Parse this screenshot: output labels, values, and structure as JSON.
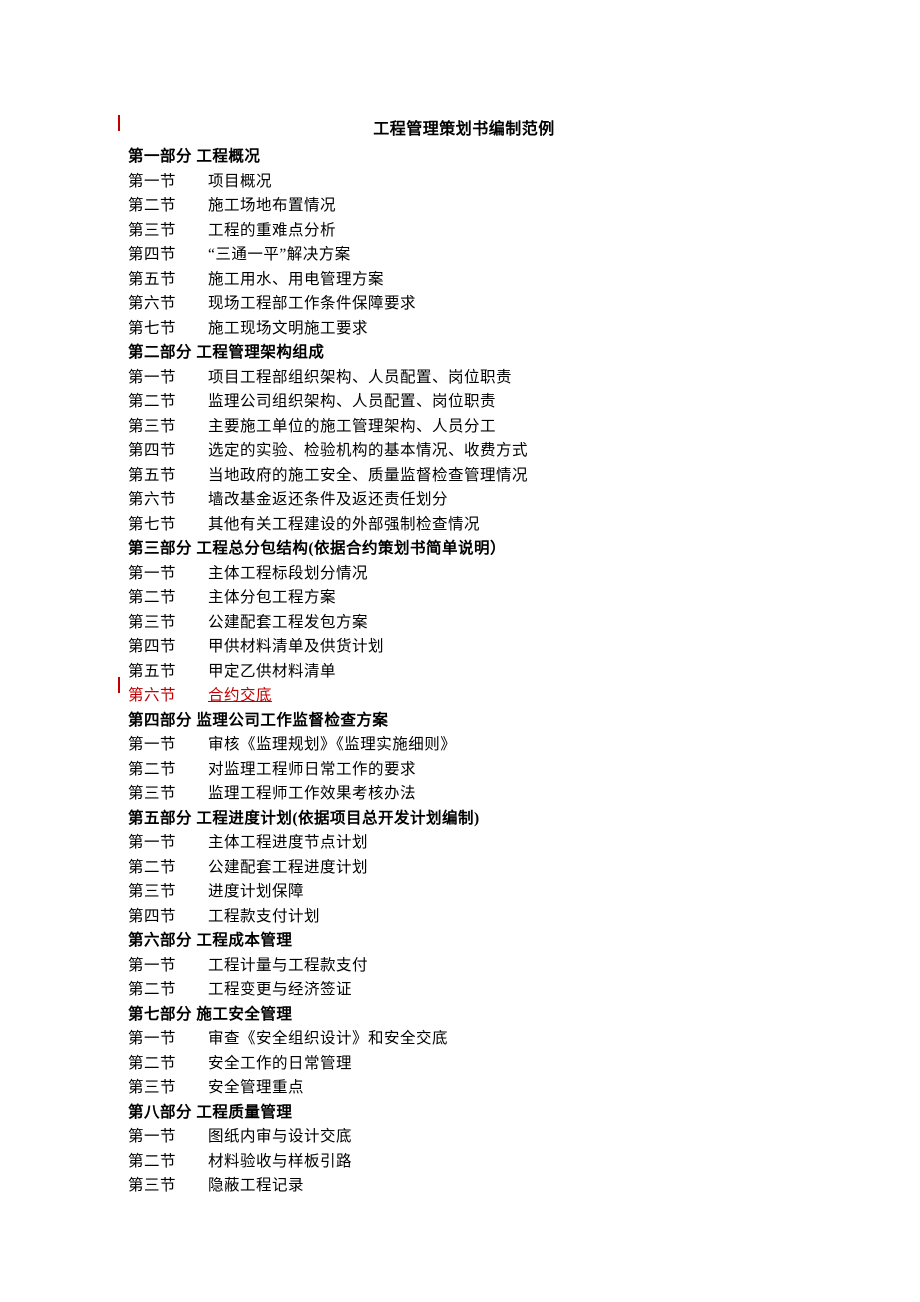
{
  "title": "工程管理策划书编制范例",
  "parts": [
    {
      "label": "第一部分",
      "name": "工程概况",
      "sections": [
        {
          "label": "第一节",
          "text": "项目概况"
        },
        {
          "label": "第二节",
          "text": "施工场地布置情况"
        },
        {
          "label": "第三节",
          "text": "工程的重难点分析"
        },
        {
          "label": "第四节",
          "text": "“三通一平”解决方案"
        },
        {
          "label": "第五节",
          "text": "施工用水、用电管理方案"
        },
        {
          "label": "第六节",
          "text": "现场工程部工作条件保障要求"
        },
        {
          "label": "第七节",
          "text": "施工现场文明施工要求"
        }
      ]
    },
    {
      "label": "第二部分",
      "name": "工程管理架构组成",
      "sections": [
        {
          "label": "第一节",
          "text": "项目工程部组织架构、人员配置、岗位职责"
        },
        {
          "label": "第二节",
          "text": "监理公司组织架构、人员配置、岗位职责"
        },
        {
          "label": "第三节",
          "text": "主要施工单位的施工管理架构、人员分工"
        },
        {
          "label": "第四节",
          "text": "选定的实验、检验机构的基本情况、收费方式"
        },
        {
          "label": "第五节",
          "text": "当地政府的施工安全、质量监督检查管理情况"
        },
        {
          "label": "第六节",
          "text": "墙改基金返还条件及返还责任划分"
        },
        {
          "label": "第七节",
          "text": "其他有关工程建设的外部强制检查情况"
        }
      ]
    },
    {
      "label": "第三部分",
      "name": "工程总分包结构(依据合约策划书简单说明）",
      "sections": [
        {
          "label": "第一节",
          "text": "主体工程标段划分情况"
        },
        {
          "label": "第二节",
          "text": "主体分包工程方案"
        },
        {
          "label": "第三节",
          "text": "公建配套工程发包方案"
        },
        {
          "label": "第四节",
          "text": "甲供材料清单及供货计划"
        },
        {
          "label": "第五节",
          "text": "甲定乙供材料清单"
        },
        {
          "label": "第六节",
          "text": "合约交底",
          "highlight": true
        }
      ]
    },
    {
      "label": "第四部分",
      "name": "监理公司工作监督检查方案",
      "sections": [
        {
          "label": "第一节",
          "text": "审核《监理规划》《监理实施细则》"
        },
        {
          "label": "第二节",
          "text": "对监理工程师日常工作的要求"
        },
        {
          "label": "第三节",
          "text": "监理工程师工作效果考核办法"
        }
      ]
    },
    {
      "label": "第五部分",
      "name": "工程进度计划(依据项目总开发计划编制)",
      "sections": [
        {
          "label": "第一节",
          "text": "主体工程进度节点计划"
        },
        {
          "label": "第二节",
          "text": "公建配套工程进度计划"
        },
        {
          "label": "第三节",
          "text": "进度计划保障"
        },
        {
          "label": "第四节",
          "text": "工程款支付计划"
        }
      ]
    },
    {
      "label": "第六部分",
      "name": "工程成本管理",
      "sections": [
        {
          "label": "第一节",
          "text": "工程计量与工程款支付"
        },
        {
          "label": "第二节",
          "text": "工程变更与经济签证"
        }
      ]
    },
    {
      "label": "第七部分",
      "name": "施工安全管理",
      "sections": [
        {
          "label": "第一节",
          "text": "审查《安全组织设计》和安全交底"
        },
        {
          "label": "第二节",
          "text": "安全工作的日常管理"
        },
        {
          "label": "第三节",
          "text": "安全管理重点"
        }
      ]
    },
    {
      "label": "第八部分",
      "name": "工程质量管理",
      "sections": [
        {
          "label": "第一节",
          "text": "图纸内审与设计交底"
        },
        {
          "label": "第二节",
          "text": "材料验收与样板引路"
        },
        {
          "label": "第三节",
          "text": "隐蔽工程记录"
        }
      ]
    }
  ]
}
